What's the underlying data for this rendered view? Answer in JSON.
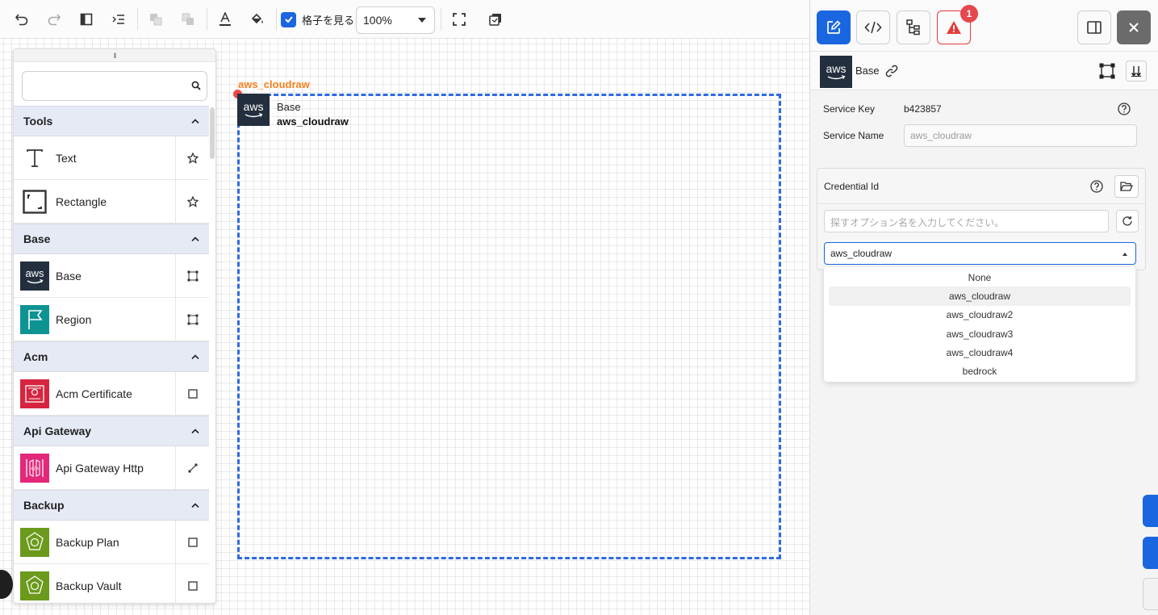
{
  "toolbar": {
    "grid_toggle_label": "格子を見る",
    "grid_toggle_checked": true,
    "zoom_value": "100%"
  },
  "palette": {
    "search_placeholder": "",
    "categories": [
      {
        "name": "Tools",
        "items": [
          {
            "label": "Text",
            "icon": "text-icon",
            "action_icon": "star-icon"
          },
          {
            "label": "Rectangle",
            "icon": "rectangle-icon",
            "action_icon": "star-icon"
          }
        ]
      },
      {
        "name": "Base",
        "items": [
          {
            "label": "Base",
            "icon": "aws-logo-icon",
            "action_icon": "group-frame-icon"
          },
          {
            "label": "Region",
            "icon": "region-flag-icon",
            "action_icon": "group-frame-icon"
          }
        ]
      },
      {
        "name": "Acm",
        "items": [
          {
            "label": "Acm Certificate",
            "icon": "acm-certificate-icon",
            "action_icon": "square-icon"
          }
        ]
      },
      {
        "name": "Api Gateway",
        "items": [
          {
            "label": "Api Gateway Http",
            "icon": "api-gateway-icon",
            "action_icon": "edge-icon"
          }
        ]
      },
      {
        "name": "Backup",
        "items": [
          {
            "label": "Backup Plan",
            "icon": "backup-plan-icon",
            "action_icon": "square-icon"
          },
          {
            "label": "Backup Vault",
            "icon": "backup-vault-icon",
            "action_icon": "square-icon"
          }
        ]
      }
    ]
  },
  "diagram": {
    "node_title": "aws_cloudraw",
    "node_type": "Base",
    "node_name": "aws_cloudraw",
    "logo_text": "aws"
  },
  "right_panel": {
    "warning_count": "1",
    "header": {
      "logo_text": "aws",
      "name": "Base"
    },
    "service_key_label": "Service Key",
    "service_key_value": "b423857",
    "service_name_label": "Service Name",
    "service_name_value": "aws_cloudraw",
    "credential": {
      "title": "Credential Id",
      "search_placeholder": "探すオプション名を入力してください。",
      "selected": "aws_cloudraw",
      "options": [
        "None",
        "aws_cloudraw",
        "aws_cloudraw2",
        "aws_cloudraw3",
        "aws_cloudraw4",
        "bedrock"
      ]
    }
  },
  "colors": {
    "accent": "#1a66e0",
    "node_title": "#f58220",
    "warning": "#e5484d",
    "aws_dark": "#232f3e"
  }
}
